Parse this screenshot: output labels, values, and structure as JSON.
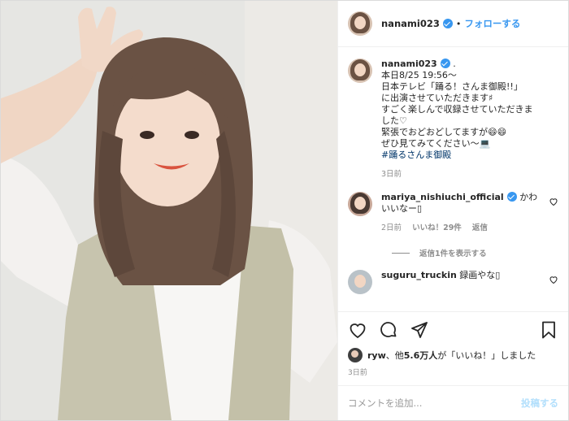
{
  "header": {
    "username": "nanami023",
    "separator": "•",
    "follow_label": "フォローする"
  },
  "caption": {
    "username": "nanami023",
    "suffix": ".",
    "lines": [
      "本日8/25 19:56〜",
      "日本テレビ「踊る！さんま御殿!!」",
      "に出演させていただきます♯",
      "すごく楽しんで収録させていただきま",
      "した♡",
      "緊張でおどおどしてますが😄😄",
      "ぜひ見てみてください〜💻"
    ],
    "hashtag": "#踊るさんま御殿",
    "time": "3日前"
  },
  "comments": [
    {
      "username": "mariya_nishiuchi_official",
      "text_1": "かわ",
      "text_2": "いいなー▯",
      "time": "2日前",
      "likes": "いいね！29件",
      "reply": "返信",
      "view_replies": "返信1件を表示する"
    },
    {
      "username": "suguru_truckin",
      "text": "録画やな▯"
    }
  ],
  "likes_line": {
    "user": "ryw",
    "middle": "、他",
    "count": "5.6万人",
    "tail": "が「いいね！」しました"
  },
  "post_date": "3日前",
  "add_comment": {
    "placeholder": "コメントを追加...",
    "post_label": "投稿する"
  },
  "icons": [
    "heart-icon",
    "comment-icon",
    "share-icon",
    "bookmark-icon",
    "verified-icon"
  ],
  "colors": {
    "accent": "#3897f0",
    "muted": "#8e8e8e",
    "hashtag": "#003569",
    "post_disabled": "#b2dffc"
  }
}
